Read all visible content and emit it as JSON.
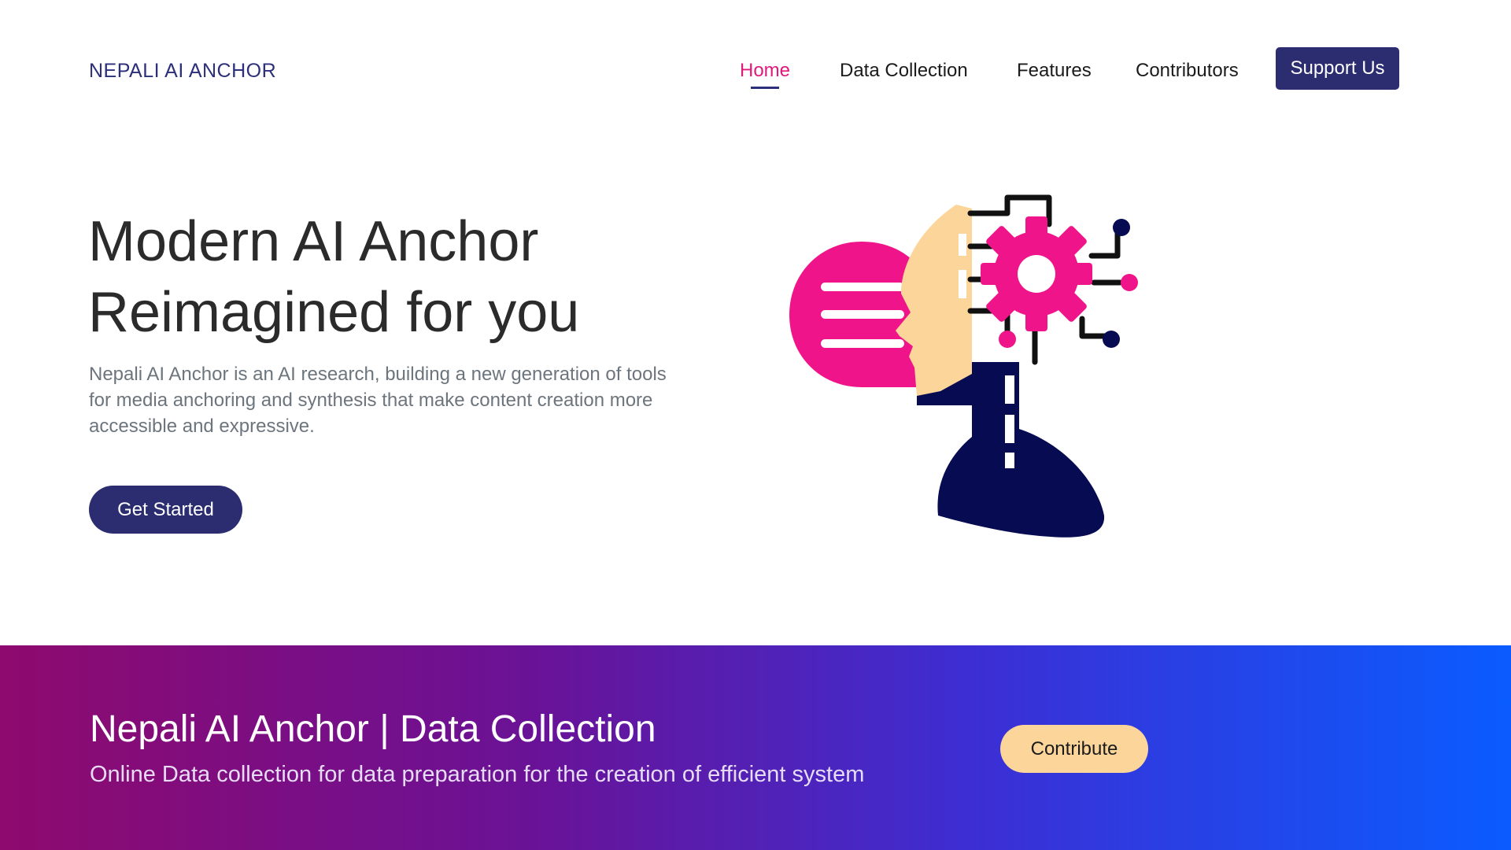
{
  "brand": {
    "logo_text": "NEPALI AI ANCHOR"
  },
  "nav": {
    "items": [
      {
        "label": "Home",
        "active": true
      },
      {
        "label": "Data Collection",
        "active": false
      },
      {
        "label": "Features",
        "active": false
      },
      {
        "label": "Contributors",
        "active": false
      }
    ],
    "cta_label": "Support Us"
  },
  "hero": {
    "title_line1": "Modern AI Anchor",
    "title_line2": "Reimagined for you",
    "description": "Nepali AI Anchor is an AI research, building a new generation of tools for media anchoring and synthesis that make content creation more accessible and expressive.",
    "button_label": "Get Started",
    "illustration_icon": "ai-head-gear-chat-illustration"
  },
  "cta_section": {
    "title": "Nepali AI Anchor | Data Collection",
    "subtitle": "Online Data collection for data preparation for the creation of efficient system",
    "button_label": "Contribute"
  },
  "colors": {
    "primary": "#2c2d71",
    "accent_pink": "#e0197d",
    "accent_peach": "#fcd59a",
    "gradient_start": "#8e0a6e",
    "gradient_end": "#0a5cff"
  }
}
